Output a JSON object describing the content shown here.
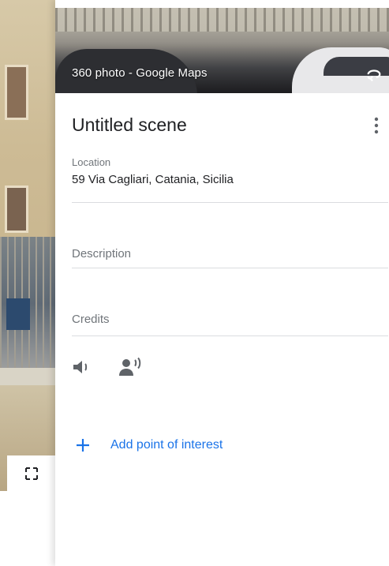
{
  "header": {
    "photo_title": "360 photo - Google Maps"
  },
  "scene": {
    "title": "Untitled scene"
  },
  "location": {
    "label": "Location",
    "value": "59 Via Cagliari, Catania, Sicilia"
  },
  "description": {
    "placeholder": "Description"
  },
  "credits": {
    "placeholder": "Credits"
  },
  "audio": {
    "icons": [
      "sound-icon",
      "narration-icon"
    ]
  },
  "poi": {
    "add_label": "Add point of interest"
  },
  "colors": {
    "accent": "#1a73e8",
    "text": "#202124",
    "muted": "#70757a",
    "divider": "#dadce0"
  }
}
